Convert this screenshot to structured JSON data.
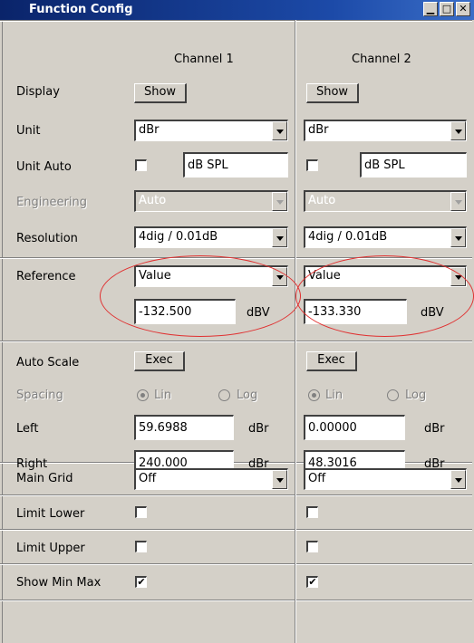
{
  "window": {
    "title": "Function Config",
    "min_icon": "minimize-icon",
    "max_icon": "maximize-icon",
    "close_icon": "close-icon"
  },
  "columns": {
    "ch1": "Channel 1",
    "ch2": "Channel 2"
  },
  "labels": {
    "display": "Display",
    "unit": "Unit",
    "unit_auto": "Unit Auto",
    "engineering": "Engineering",
    "resolution": "Resolution",
    "reference": "Reference",
    "auto_scale": "Auto Scale",
    "spacing": "Spacing",
    "left": "Left",
    "right": "Right",
    "main_grid": "Main Grid",
    "limit_lower": "Limit Lower",
    "limit_upper": "Limit Upper",
    "show_min_max": "Show Min Max"
  },
  "ch1": {
    "display_btn": "Show",
    "unit": "dBr",
    "unit_auto_checked": false,
    "unit_auto_text": "dB SPL",
    "engineering": "Auto",
    "resolution": "4dig / 0.01dB",
    "reference": "Value",
    "reference_value": "-132.500",
    "reference_unit": "dBV",
    "auto_scale_btn": "Exec",
    "spacing_lin": "Lin",
    "spacing_log": "Log",
    "left": "59.6988",
    "left_unit": "dBr",
    "right": "240.000",
    "right_unit": "dBr",
    "main_grid": "Off",
    "limit_lower_checked": false,
    "limit_upper_checked": false,
    "show_min_max_checked": true
  },
  "ch2": {
    "display_btn": "Show",
    "unit": "dBr",
    "unit_auto_checked": false,
    "unit_auto_text": "dB SPL",
    "engineering": "Auto",
    "resolution": "4dig / 0.01dB",
    "reference": "Value",
    "reference_value": "-133.330",
    "reference_unit": "dBV",
    "auto_scale_btn": "Exec",
    "spacing_lin": "Lin",
    "spacing_log": "Log",
    "left": "0.00000",
    "left_unit": "dBr",
    "right": "48.3016",
    "right_unit": "dBr",
    "main_grid": "Off",
    "limit_lower_checked": false,
    "limit_upper_checked": false,
    "show_min_max_checked": true
  },
  "check_mark": "✔",
  "annotation_color": "#e03030",
  "accent_color": "#0a246a"
}
